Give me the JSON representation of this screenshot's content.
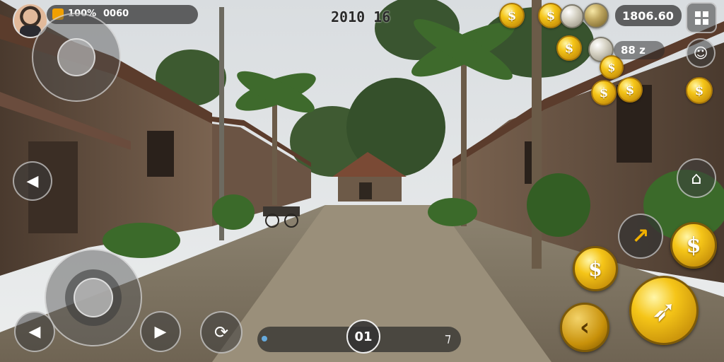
{
  "hud": {
    "currency_label": "100%",
    "currency_value": "0060",
    "timer": "2010 16",
    "score": "1806.60",
    "multiplier": "88 z",
    "action_counter": "01"
  },
  "icons": {
    "avatar": "player-avatar",
    "menu": "grid-menu-icon",
    "face": "face-icon",
    "up": "up-arrow-icon",
    "left": "left-arrow-icon",
    "right": "right-arrow-icon",
    "refresh": "refresh-icon",
    "coin_glyph": "$",
    "jump": "jump-icon",
    "back": "back-icon",
    "attack": "attack-icon"
  },
  "colors": {
    "gold": "#f5c518",
    "hud_bg": "#282828",
    "text": "#ffffff"
  }
}
